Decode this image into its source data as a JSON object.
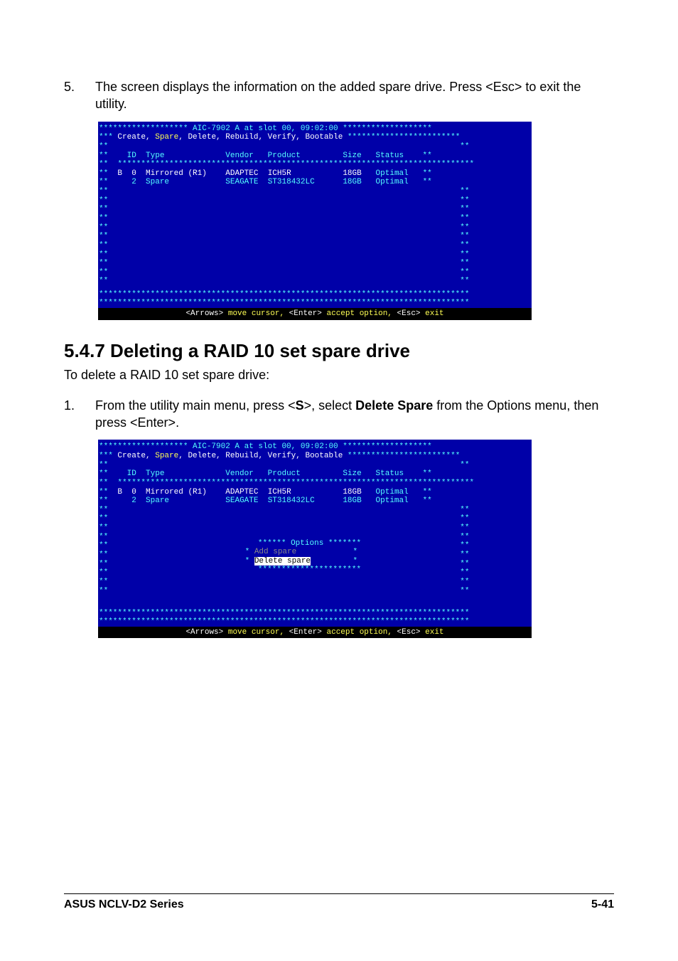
{
  "step5": {
    "num": "5.",
    "text": "The screen displays the information on the added spare drive. Press <Esc> to exit the utility."
  },
  "bios_title": "******************* AIC-7902 A at slot 00, 09:02:00 *******************",
  "bios_menu_prefix_stars": "*** ",
  "bios_menu_items": {
    "create": "Create",
    "spare": "Spare",
    "delete": "Delete",
    "rebuild": "Rebuild",
    "verify": "Verify",
    "bootable": "Bootable"
  },
  "bios_menu_suffix_stars": " ************************",
  "bios_side_star": "**",
  "bios_header": {
    "id": "ID",
    "type": "Type",
    "vendor": "Vendor",
    "product": "Product",
    "size": "Size",
    "status": "Status"
  },
  "bios_sep_line": "  ****************************************************************************",
  "bios_rows": {
    "r1": {
      "b": "B",
      "id": "0",
      "type": "Mirrored (R1)",
      "vendor": "ADAPTEC",
      "product": "ICH5R",
      "size": "18GB",
      "status": "Optimal"
    },
    "r2": {
      "b": " ",
      "id": "2",
      "type": "Spare",
      "vendor": "SEAGATE",
      "product": "ST318432LC",
      "size": "18GB",
      "status": "Optimal"
    }
  },
  "bios_bottom_line1": "*******************************************************************************",
  "bios_bottom_line2": "*******************************************************************************",
  "bios_help": {
    "p1": "<Arrows>",
    "t1": " move cursor, ",
    "p2": "<Enter>",
    "t2": " accept option, ",
    "p3": "<Esc>",
    "t3": " exit"
  },
  "heading": "5.4.7   Deleting a RAID 10 set spare drive",
  "heading_sub": "To delete a RAID 10 set spare drive:",
  "step1": {
    "num": "1.",
    "pre": "From the utility main menu, press <",
    "s": "S",
    "mid": ">, select ",
    "bold": "Delete Spare",
    "post": " from the Options menu, then press <Enter>."
  },
  "options_popup": {
    "title_line": "****** Options *******",
    "add_label": "Add spare",
    "delete_label": "Delete spare",
    "bottom_line": "**********************"
  },
  "footer": {
    "left": "ASUS NCLV-D2 Series",
    "right": "5-41"
  }
}
